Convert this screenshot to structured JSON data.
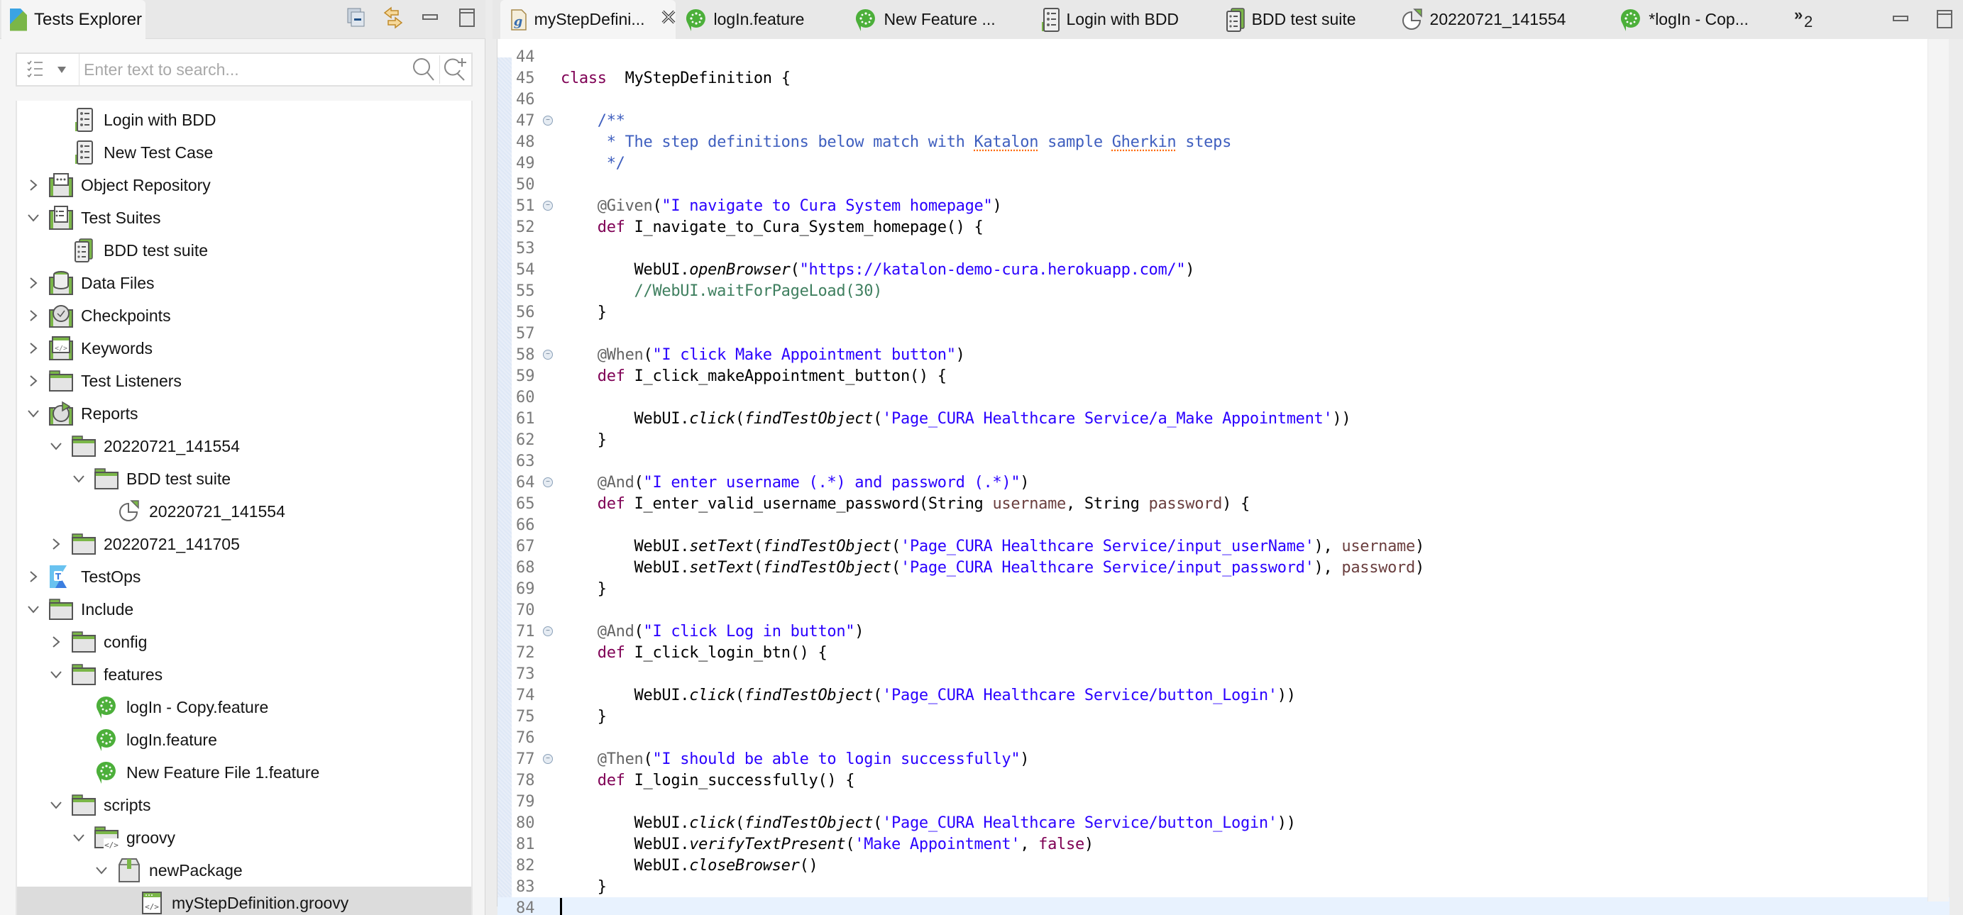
{
  "left_panel": {
    "tab_title": "Tests Explorer",
    "tools": [
      "collapse-all-icon",
      "link-with-editor-icon",
      "minimize-icon",
      "maximize-icon"
    ],
    "search": {
      "placeholder": "Enter text to search...",
      "value": ""
    },
    "tree": [
      {
        "label": "Login with BDD",
        "depth": 2,
        "twisty": "none",
        "icon": "test-case-icon"
      },
      {
        "label": "New Test Case",
        "depth": 2,
        "twisty": "none",
        "icon": "test-case-icon"
      },
      {
        "label": "Object Repository",
        "depth": 1,
        "twisty": "collapsed",
        "icon": "object-repository-icon"
      },
      {
        "label": "Test Suites",
        "depth": 1,
        "twisty": "expanded",
        "icon": "test-suites-icon"
      },
      {
        "label": "BDD test suite",
        "depth": 2,
        "twisty": "none",
        "icon": "test-suite-icon"
      },
      {
        "label": "Data Files",
        "depth": 1,
        "twisty": "collapsed",
        "icon": "data-files-icon"
      },
      {
        "label": "Checkpoints",
        "depth": 1,
        "twisty": "collapsed",
        "icon": "checkpoints-icon"
      },
      {
        "label": "Keywords",
        "depth": 1,
        "twisty": "collapsed",
        "icon": "keywords-icon"
      },
      {
        "label": "Test Listeners",
        "depth": 1,
        "twisty": "collapsed",
        "icon": "folder-icon"
      },
      {
        "label": "Reports",
        "depth": 1,
        "twisty": "expanded",
        "icon": "reports-icon"
      },
      {
        "label": "20220721_141554",
        "depth": 2,
        "twisty": "expanded",
        "icon": "folder-icon"
      },
      {
        "label": "BDD test suite",
        "depth": 3,
        "twisty": "expanded",
        "icon": "folder-icon"
      },
      {
        "label": "20220721_141554",
        "depth": 4,
        "twisty": "none",
        "icon": "report-icon"
      },
      {
        "label": "20220721_141705",
        "depth": 2,
        "twisty": "collapsed",
        "icon": "folder-icon"
      },
      {
        "label": "TestOps",
        "depth": 1,
        "twisty": "collapsed",
        "icon": "testops-icon"
      },
      {
        "label": "Include",
        "depth": 1,
        "twisty": "expanded",
        "icon": "folder-icon"
      },
      {
        "label": "config",
        "depth": 2,
        "twisty": "collapsed",
        "icon": "folder-icon"
      },
      {
        "label": "features",
        "depth": 2,
        "twisty": "expanded",
        "icon": "folder-icon"
      },
      {
        "label": "logIn - Copy.feature",
        "depth": 3,
        "twisty": "none",
        "icon": "cucumber-icon"
      },
      {
        "label": "logIn.feature",
        "depth": 3,
        "twisty": "none",
        "icon": "cucumber-icon"
      },
      {
        "label": "New Feature File 1.feature",
        "depth": 3,
        "twisty": "none",
        "icon": "cucumber-icon"
      },
      {
        "label": "scripts",
        "depth": 2,
        "twisty": "expanded",
        "icon": "folder-icon"
      },
      {
        "label": "groovy",
        "depth": 3,
        "twisty": "expanded",
        "icon": "source-folder-icon"
      },
      {
        "label": "newPackage",
        "depth": 4,
        "twisty": "expanded",
        "icon": "package-icon"
      },
      {
        "label": "myStepDefinition.groovy",
        "depth": 5,
        "twisty": "none",
        "icon": "groovy-file-icon",
        "selected": true
      }
    ]
  },
  "editor": {
    "tabs": [
      {
        "label": "myStepDefini...",
        "icon": "groovy-file-icon",
        "active": true,
        "closable": true
      },
      {
        "label": "logIn.feature",
        "icon": "cucumber-icon"
      },
      {
        "label": "New Feature ...",
        "icon": "cucumber-icon"
      },
      {
        "label": "Login with BDD",
        "icon": "test-case-icon"
      },
      {
        "label": "BDD test suite",
        "icon": "test-suite-icon"
      },
      {
        "label": "20220721_141554",
        "icon": "report-icon"
      },
      {
        "label": "*logIn - Cop...",
        "icon": "cucumber-icon"
      }
    ],
    "overflow_chevron": "»",
    "overflow_count": "2",
    "tools": [
      "minimize-icon",
      "maximize-icon"
    ],
    "current_line": 84,
    "lines": [
      {
        "n": "44",
        "tokens": []
      },
      {
        "n": "45",
        "tokens": [
          [
            "kw",
            "class"
          ],
          [
            "",
            "  MyStepDefinition {"
          ]
        ]
      },
      {
        "n": "46",
        "tokens": []
      },
      {
        "n": "47",
        "fold": true,
        "tokens": [
          [
            "cm",
            "    /**"
          ]
        ]
      },
      {
        "n": "48",
        "tokens": [
          [
            "cm",
            "     * The step definitions below match with "
          ],
          [
            "cm spell",
            "Katalon"
          ],
          [
            "cm",
            " sample "
          ],
          [
            "cm spell",
            "Gherkin"
          ],
          [
            "cm",
            " steps"
          ]
        ]
      },
      {
        "n": "49",
        "tokens": [
          [
            "cm",
            "     */"
          ]
        ]
      },
      {
        "n": "50",
        "tokens": []
      },
      {
        "n": "51",
        "fold": true,
        "tokens": [
          [
            "ann",
            "    @Given"
          ],
          [
            "",
            "("
          ],
          [
            "str",
            "\"I navigate to Cura System homepage\""
          ],
          [
            "",
            ")"
          ]
        ]
      },
      {
        "n": "52",
        "tokens": [
          [
            "kw",
            "    def"
          ],
          [
            "",
            " I_navigate_to_Cura_System_homepage() {"
          ]
        ]
      },
      {
        "n": "53",
        "tokens": []
      },
      {
        "n": "54",
        "tokens": [
          [
            "",
            "        WebUI."
          ],
          [
            "it",
            "openBrowser"
          ],
          [
            "",
            "("
          ],
          [
            "str",
            "\"https://katalon-demo-cura.herokuapp.com/\""
          ],
          [
            "",
            ")"
          ]
        ]
      },
      {
        "n": "55",
        "tokens": [
          [
            "lc",
            "        //WebUI.waitForPageLoad(30)"
          ]
        ]
      },
      {
        "n": "56",
        "tokens": [
          [
            "",
            "    }"
          ]
        ]
      },
      {
        "n": "57",
        "tokens": []
      },
      {
        "n": "58",
        "fold": true,
        "tokens": [
          [
            "ann",
            "    @When"
          ],
          [
            "",
            "("
          ],
          [
            "str",
            "\"I click Make Appointment button\""
          ],
          [
            "",
            ")"
          ]
        ]
      },
      {
        "n": "59",
        "tokens": [
          [
            "kw",
            "    def"
          ],
          [
            "",
            " I_click_makeAppointment_button() {"
          ]
        ]
      },
      {
        "n": "60",
        "tokens": []
      },
      {
        "n": "61",
        "tokens": [
          [
            "",
            "        WebUI."
          ],
          [
            "it",
            "click"
          ],
          [
            "",
            "("
          ],
          [
            "it",
            "findTestObject"
          ],
          [
            "",
            "("
          ],
          [
            "str",
            "'Page_CURA Healthcare Service/a_Make Appointment'"
          ],
          [
            "",
            "))"
          ]
        ]
      },
      {
        "n": "62",
        "tokens": [
          [
            "",
            "    }"
          ]
        ]
      },
      {
        "n": "63",
        "tokens": []
      },
      {
        "n": "64",
        "fold": true,
        "tokens": [
          [
            "ann",
            "    @And"
          ],
          [
            "",
            "("
          ],
          [
            "str",
            "\"I enter username (.*) and password (.*)\""
          ],
          [
            "",
            ")"
          ]
        ]
      },
      {
        "n": "65",
        "tokens": [
          [
            "kw",
            "    def"
          ],
          [
            "",
            " I_enter_valid_username_password(String "
          ],
          [
            "param",
            "username"
          ],
          [
            "",
            ", String "
          ],
          [
            "param",
            "password"
          ],
          [
            "",
            ") {"
          ]
        ]
      },
      {
        "n": "66",
        "tokens": []
      },
      {
        "n": "67",
        "tokens": [
          [
            "",
            "        WebUI."
          ],
          [
            "it",
            "setText"
          ],
          [
            "",
            "("
          ],
          [
            "it",
            "findTestObject"
          ],
          [
            "",
            "("
          ],
          [
            "str",
            "'Page_CURA Healthcare Service/input_userName'"
          ],
          [
            "",
            "), "
          ],
          [
            "param",
            "username"
          ],
          [
            "",
            ")"
          ]
        ]
      },
      {
        "n": "68",
        "tokens": [
          [
            "",
            "        WebUI."
          ],
          [
            "it",
            "setText"
          ],
          [
            "",
            "("
          ],
          [
            "it",
            "findTestObject"
          ],
          [
            "",
            "("
          ],
          [
            "str",
            "'Page_CURA Healthcare Service/input_password'"
          ],
          [
            "",
            "), "
          ],
          [
            "param",
            "password"
          ],
          [
            "",
            ")"
          ]
        ]
      },
      {
        "n": "69",
        "tokens": [
          [
            "",
            "    }"
          ]
        ]
      },
      {
        "n": "70",
        "tokens": []
      },
      {
        "n": "71",
        "fold": true,
        "tokens": [
          [
            "ann",
            "    @And"
          ],
          [
            "",
            "("
          ],
          [
            "str",
            "\"I click Log in button\""
          ],
          [
            "",
            ")"
          ]
        ]
      },
      {
        "n": "72",
        "tokens": [
          [
            "kw",
            "    def"
          ],
          [
            "",
            " I_click_login_btn() {"
          ]
        ]
      },
      {
        "n": "73",
        "tokens": []
      },
      {
        "n": "74",
        "tokens": [
          [
            "",
            "        WebUI."
          ],
          [
            "it",
            "click"
          ],
          [
            "",
            "("
          ],
          [
            "it",
            "findTestObject"
          ],
          [
            "",
            "("
          ],
          [
            "str",
            "'Page_CURA Healthcare Service/button_Login'"
          ],
          [
            "",
            "))"
          ]
        ]
      },
      {
        "n": "75",
        "tokens": [
          [
            "",
            "    }"
          ]
        ]
      },
      {
        "n": "76",
        "tokens": []
      },
      {
        "n": "77",
        "fold": true,
        "tokens": [
          [
            "ann",
            "    @Then"
          ],
          [
            "",
            "("
          ],
          [
            "str",
            "\"I should be able to login successfully\""
          ],
          [
            "",
            ")"
          ]
        ]
      },
      {
        "n": "78",
        "tokens": [
          [
            "kw",
            "    def"
          ],
          [
            "",
            " I_login_successfully() {"
          ]
        ]
      },
      {
        "n": "79",
        "tokens": []
      },
      {
        "n": "80",
        "tokens": [
          [
            "",
            "        WebUI."
          ],
          [
            "it",
            "click"
          ],
          [
            "",
            "("
          ],
          [
            "it",
            "findTestObject"
          ],
          [
            "",
            "("
          ],
          [
            "str",
            "'Page_CURA Healthcare Service/button_Login'"
          ],
          [
            "",
            "))"
          ]
        ]
      },
      {
        "n": "81",
        "tokens": [
          [
            "",
            "        WebUI."
          ],
          [
            "it",
            "verifyTextPresent"
          ],
          [
            "",
            "("
          ],
          [
            "str",
            "'Make Appointment'"
          ],
          [
            "",
            ", "
          ],
          [
            "kw",
            "false"
          ],
          [
            "",
            ")"
          ]
        ]
      },
      {
        "n": "82",
        "tokens": [
          [
            "",
            "        WebUI."
          ],
          [
            "it",
            "closeBrowser"
          ],
          [
            "",
            "()"
          ]
        ]
      },
      {
        "n": "83",
        "tokens": [
          [
            "",
            "    }"
          ]
        ]
      },
      {
        "n": "84",
        "tokens": []
      }
    ]
  },
  "colors": {
    "keyword": "#7f0055",
    "string": "#2a00ff",
    "javadoc": "#3f5fbf",
    "line_comment": "#3f7f5f",
    "annotation": "#646464",
    "parameter": "#6a3e3e",
    "current_line": "#e8f2fe",
    "brand_green": "#7ab648",
    "cucumber_green": "#4caf3a"
  }
}
